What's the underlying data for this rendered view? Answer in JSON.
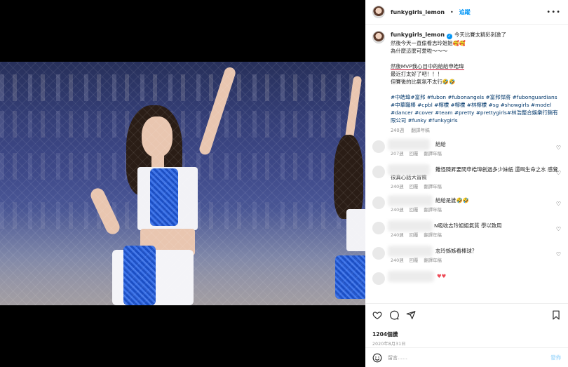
{
  "header": {
    "username": "funkygirls_lemon",
    "follow_label": "追蹤",
    "more": "•••"
  },
  "caption": {
    "username": "funkygirls_lemon",
    "lines1": [
      "今天比賽太精彩刺激了",
      "然後今天一直偷看志玲姐姐🥰🥰",
      "為什麼這麼可愛啦～～～"
    ],
    "highlight": "然後MVP我心目中的給給申皓瑋",
    "lines2": [
      "最近打太好了吧！！！",
      "但賽後的比氣氛不太行🤣🤣"
    ],
    "hashtags": "#中皓瑋#富邦 #fubon #fubonangels #富邦悍將 #fubonguardians #中華職棒 #cpbl #檸檬 #檸檬 #林檸檬 #sg #showgirls #model #dancer #cover #team #pretty #prettygirls#林浩整合娛樂行銷有限公司 #funky #funkygirls",
    "age": "240週",
    "translate": "翻譯年稿"
  },
  "comments": [
    {
      "text": "給給",
      "age": "207週",
      "reply": "回覆",
      "translate": "翻譯年稿"
    },
    {
      "text": "難怪陳昇要問申皓瑋創過多少妹紙 還喝生命之水 感覺很真心話大冒險",
      "age": "240週",
      "reply": "回覆",
      "translate": "翻譯年稿"
    },
    {
      "text": "給給是誰🤣🤣",
      "age": "240週",
      "reply": "回覆",
      "translate": "翻譯年稿"
    },
    {
      "text": "N吸收志玲姐姐氣質 學以致用",
      "age": "240週",
      "reply": "回覆",
      "translate": "翻譯年稿"
    },
    {
      "text": "志玲姊姊看棒球？",
      "age": "240週",
      "reply": "回覆",
      "translate": "翻譯年稿"
    },
    {
      "text": "♥♥",
      "age": "",
      "reply": "",
      "translate": ""
    }
  ],
  "actions": {
    "likes": "1204個讚",
    "date": "2020年8月31日"
  },
  "comment_bar": {
    "placeholder": "留言……",
    "post_label": "發佈"
  },
  "colors": {
    "link": "#0095f6",
    "hashtag": "#00376b",
    "highlight_underline": "#c8102e",
    "heart": "#ed4956"
  }
}
